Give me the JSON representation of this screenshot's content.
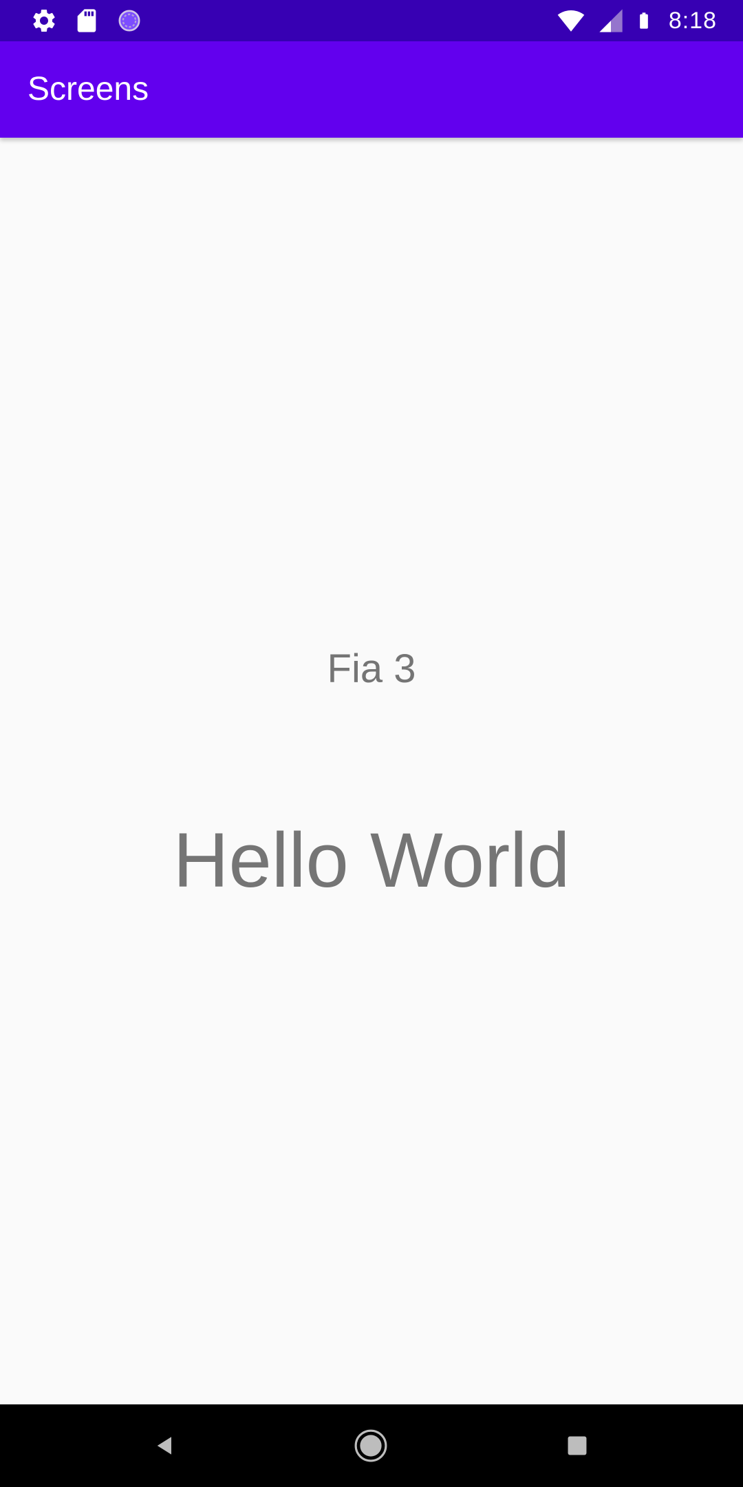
{
  "status_bar": {
    "time": "8:18",
    "background": "#3700B3",
    "icons_left": [
      "settings-icon",
      "sd-card-icon",
      "sync-progress-icon"
    ],
    "icons_right": [
      "wifi-icon",
      "cell-signal-icon",
      "battery-icon"
    ]
  },
  "app_bar": {
    "title": "Screens",
    "background": "#6200EE"
  },
  "content": {
    "subtitle": "Fia 3",
    "message": "Hello World",
    "text_color": "#757575",
    "background": "#FAFAFA"
  },
  "nav_bar": {
    "background": "#000000",
    "buttons": [
      "back-icon",
      "home-icon",
      "recents-icon"
    ]
  }
}
